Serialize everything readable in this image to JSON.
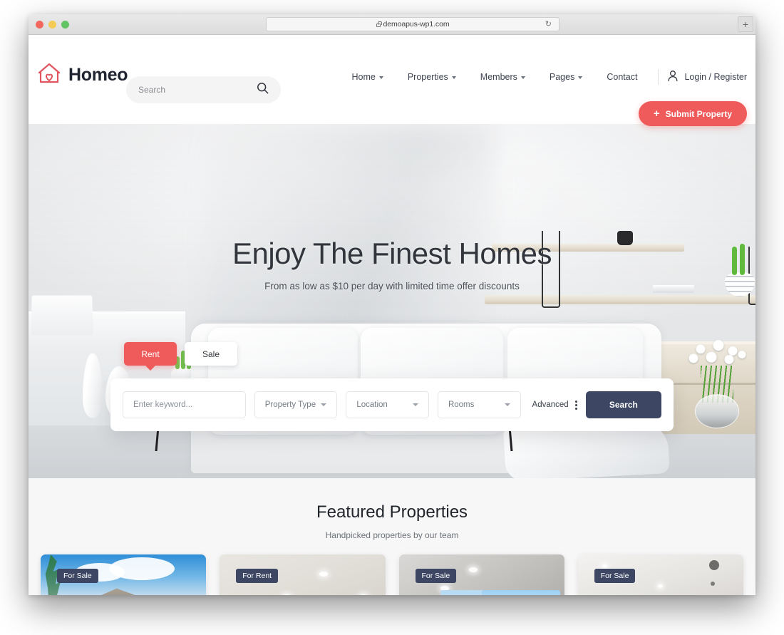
{
  "browser": {
    "url": "demoapus-wp1.com",
    "lock_icon": "lock-icon",
    "reload_icon": "reload-icon",
    "new_tab_label": "+",
    "traffic_lights": [
      "close",
      "minimize",
      "maximize"
    ]
  },
  "header": {
    "brand_name": "Homeo",
    "logo_icon": "house-heart-logo-icon",
    "search": {
      "placeholder": "Search",
      "icon": "search-icon"
    },
    "nav": [
      {
        "label": "Home",
        "has_caret": true
      },
      {
        "label": "Properties",
        "has_caret": true
      },
      {
        "label": "Members",
        "has_caret": true
      },
      {
        "label": "Pages",
        "has_caret": true
      },
      {
        "label": "Contact",
        "has_caret": false
      }
    ],
    "login": {
      "label": "Login / Register",
      "icon": "user-icon"
    },
    "submit_button": {
      "label": "Submit Property",
      "icon": "plus-icon",
      "color": "#ef5a5a"
    }
  },
  "hero": {
    "title": "Enjoy The Finest Homes",
    "subtitle": "From as low as $10 per day with limited time offer discounts",
    "tabs": [
      {
        "label": "Rent",
        "active": true
      },
      {
        "label": "Sale",
        "active": false
      }
    ],
    "search_form": {
      "keyword_placeholder": "Enter keyword...",
      "property_type": "Property Type",
      "location": "Location",
      "rooms": "Rooms",
      "advanced_label": "Advanced",
      "advanced_icon": "kebab-menu-icon",
      "search_button": "Search",
      "search_button_color": "#3d4763"
    }
  },
  "featured": {
    "title": "Featured Properties",
    "subtitle": "Handpicked properties by our team",
    "cards": [
      {
        "badge": "For Sale",
        "image": "tropical-roof-house"
      },
      {
        "badge": "For Rent",
        "image": "white-ceiling-room"
      },
      {
        "badge": "For Sale",
        "image": "grey-ceiling-windows"
      },
      {
        "badge": "For Sale",
        "image": "white-room-pendant-lights"
      }
    ]
  }
}
